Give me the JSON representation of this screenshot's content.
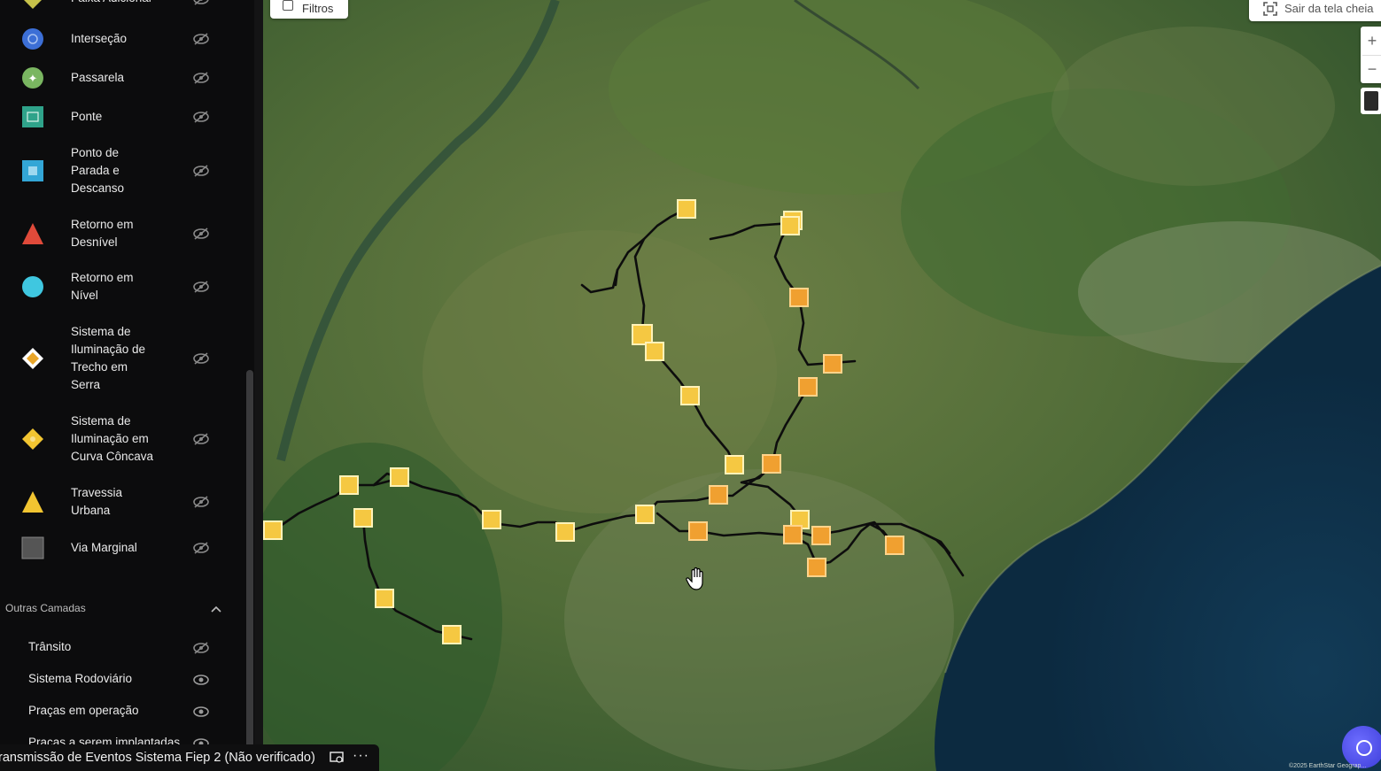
{
  "legend": {
    "items": [
      {
        "label": "Faixa Adicional",
        "icon": "faixa-adicional-icon"
      },
      {
        "label": "Interseção",
        "icon": "intersecao-icon"
      },
      {
        "label": "Passarela",
        "icon": "passarela-icon"
      },
      {
        "label": "Ponte",
        "icon": "ponte-icon"
      },
      {
        "label": "Ponto de Parada e Descanso",
        "icon": "ponto-parada-icon"
      },
      {
        "label": "Retorno em Desnível",
        "icon": "retorno-desnivel-icon"
      },
      {
        "label": "Retorno em Nível",
        "icon": "retorno-nivel-icon"
      },
      {
        "label": "Sistema de Iluminação de Trecho em Serra",
        "icon": "iluminacao-serra-icon"
      },
      {
        "label": "Sistema de Iluminação em Curva Côncava",
        "icon": "iluminacao-curva-icon"
      },
      {
        "label": "Travessia Urbana",
        "icon": "travessia-urbana-icon"
      },
      {
        "label": "Via Marginal",
        "icon": "via-marginal-icon"
      }
    ]
  },
  "other_layers": {
    "title": "Outras Camadas",
    "items": [
      {
        "label": "Trânsito",
        "visible": false
      },
      {
        "label": "Sistema Rodoviário",
        "visible": true
      },
      {
        "label": "Praças em operação",
        "visible": true
      },
      {
        "label": "Praças a serem implantadas",
        "visible": true
      }
    ]
  },
  "map": {
    "filters_label": "Filtros",
    "fullscreen_label": "Sair da tela cheia",
    "zoom_in": "+",
    "zoom_out": "−",
    "attribution": "©2025 EarthStar Geograp..."
  },
  "video_bar": {
    "title": "ransmissão de Eventos Sistema Fiep 2 (Não verificado)",
    "more": "···"
  },
  "colors": {
    "sidebar_bg": "#0c0c0d",
    "marker_yellow": "#f5c842",
    "marker_orange": "#f0a030",
    "road": "#0d0d0d",
    "ocean": "#0e2f47"
  }
}
